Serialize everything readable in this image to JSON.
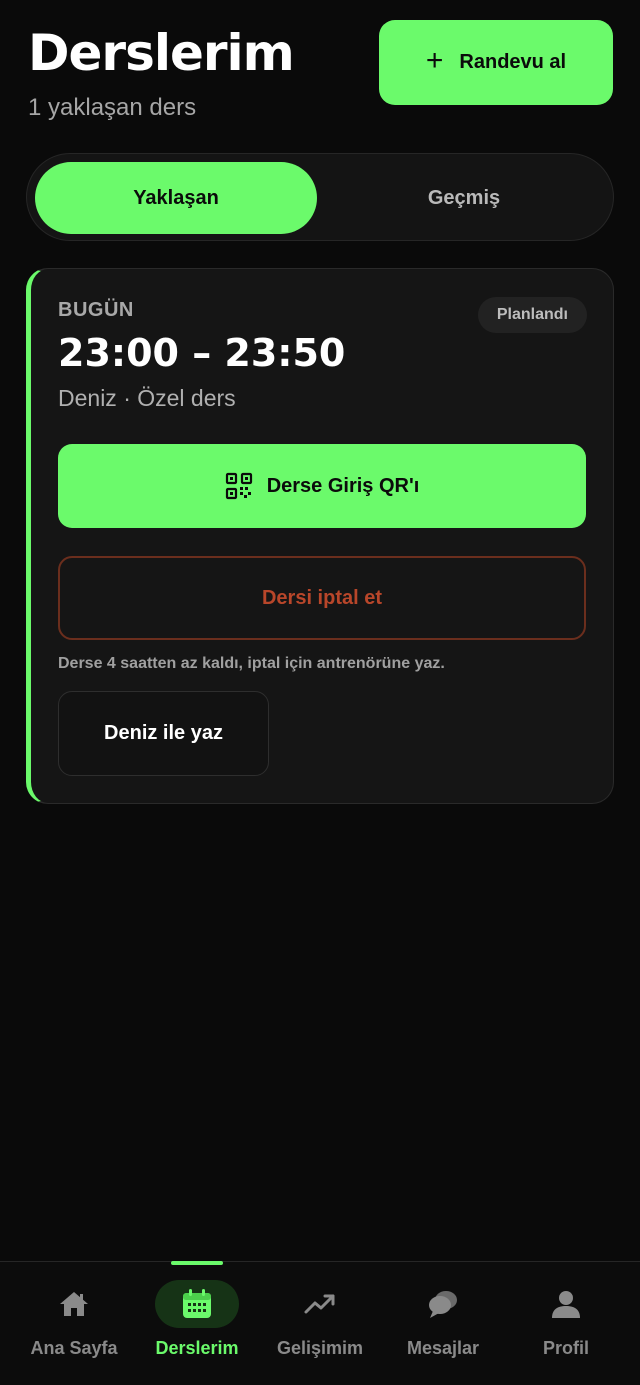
{
  "header": {
    "title": "Derslerim",
    "subtitle": "1 yaklaşan ders",
    "book_button": {
      "icon": "plus-icon",
      "label": "Randevu al"
    }
  },
  "tabs": [
    {
      "label": "Yaklaşan",
      "active": true
    },
    {
      "label": "Geçmiş",
      "active": false
    }
  ],
  "lesson": {
    "day": "BUGÜN",
    "status": "Planlandı",
    "time_range": "23:00 – 23:50",
    "info": "Deniz · Özel ders",
    "qr_button": {
      "icon": "qr-code-icon",
      "label": "Derse Giriş QR'ı"
    },
    "cancel_button": "Dersi iptal et",
    "cancel_note": "Derse 4 saatten az kaldı, iptal için antrenörüne yaz.",
    "message_button": "Deniz ile yaz"
  },
  "bottom_nav": [
    {
      "label": "Ana Sayfa",
      "icon": "home-icon",
      "active": false
    },
    {
      "label": "Derslerim",
      "icon": "calendar-icon",
      "active": true
    },
    {
      "label": "Gelişimim",
      "icon": "trend-up-icon",
      "active": false
    },
    {
      "label": "Mesajlar",
      "icon": "chat-bubbles-icon",
      "active": false
    },
    {
      "label": "Profil",
      "icon": "user-icon",
      "active": false
    }
  ],
  "colors": {
    "accent": "#6bfa6b",
    "background": "#0a0a0a",
    "danger": "#b8462a"
  }
}
